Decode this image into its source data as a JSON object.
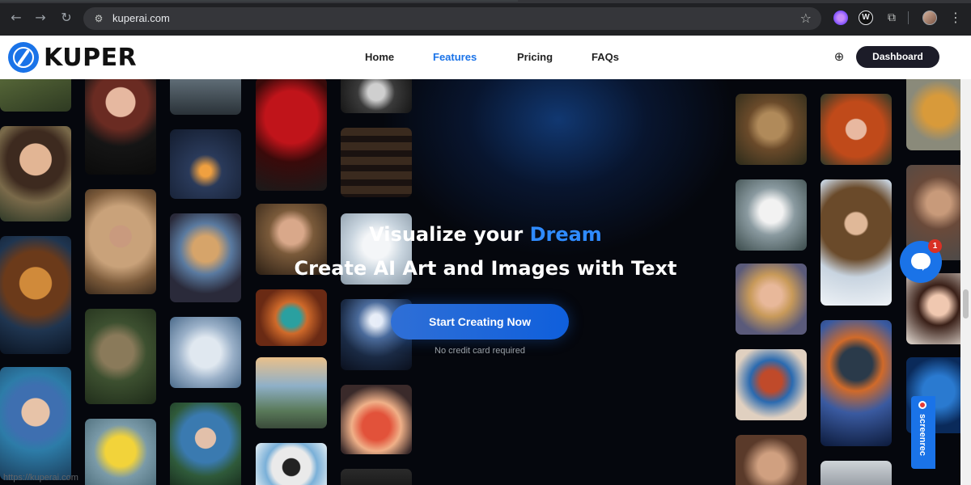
{
  "browser": {
    "url": "kuperai.com",
    "back_icon": "←",
    "forward_icon": "→",
    "reload_icon": "↻",
    "site_icon": "⚙",
    "star_icon": "☆",
    "ext_w_label": "W",
    "puzzle_icon": "⧉",
    "menu_icon": "⋮",
    "status_url": "https://kuperai.com"
  },
  "header": {
    "logo_text": "KUPER",
    "nav": [
      "Home",
      "Features",
      "Pricing",
      "FAQs"
    ],
    "active_nav": "Features",
    "globe_icon": "⊕",
    "dashboard_label": "Dashboard"
  },
  "hero": {
    "title_pre": "Visualize your ",
    "title_accent": "Dream",
    "subtitle": "Create AI Art and Images with Text",
    "cta_label": "Start Creating Now",
    "cta_note": "No credit card required"
  },
  "chat": {
    "badge_count": "1"
  },
  "screenrec": {
    "label": "screenrec"
  },
  "colors": {
    "accent": "#1a73e8",
    "hero_bg": "#05070d",
    "dashboard_bg": "#1c1c28"
  }
}
